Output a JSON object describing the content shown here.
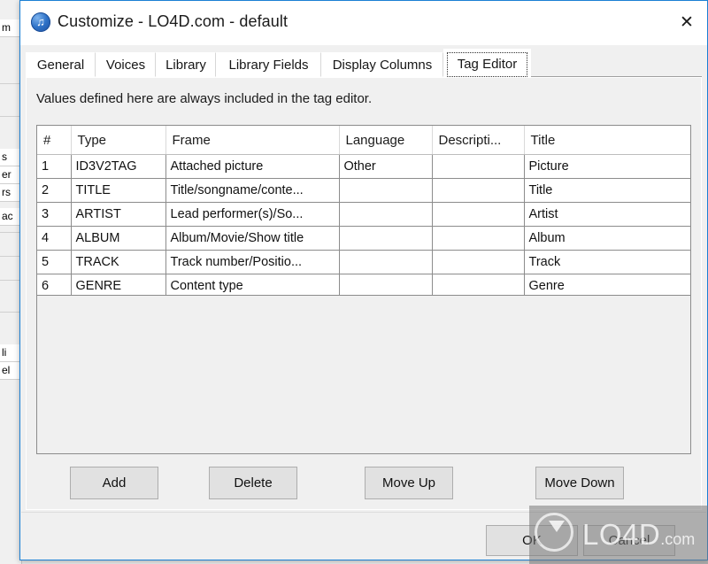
{
  "window": {
    "title": "Customize - LO4D.com - default",
    "icon": "music-note-icon",
    "close_label": "✕",
    "accent_border": "#1a7fd4"
  },
  "tabs": [
    {
      "label": "General",
      "active": false
    },
    {
      "label": "Voices",
      "active": false
    },
    {
      "label": "Library",
      "active": false
    },
    {
      "label": "Library Fields",
      "active": false
    },
    {
      "label": "Display Columns",
      "active": false
    },
    {
      "label": "Tag Editor",
      "active": true
    }
  ],
  "panel": {
    "description": "Values defined here are always included in the tag editor."
  },
  "grid": {
    "columns": [
      "#",
      "Type",
      "Frame",
      "Language",
      "Descripti...",
      "Title"
    ],
    "rows": [
      {
        "num": "1",
        "type": "ID3V2TAG",
        "frame": "Attached picture",
        "language": "Other",
        "description": "",
        "title": "Picture"
      },
      {
        "num": "2",
        "type": "TITLE",
        "frame": "Title/songname/conte...",
        "language": "",
        "description": "",
        "title": "Title"
      },
      {
        "num": "3",
        "type": "ARTIST",
        "frame": "Lead performer(s)/So...",
        "language": "",
        "description": "",
        "title": "Artist"
      },
      {
        "num": "4",
        "type": "ALBUM",
        "frame": "Album/Movie/Show title",
        "language": "",
        "description": "",
        "title": "Album"
      },
      {
        "num": "5",
        "type": "TRACK",
        "frame": "Track number/Positio...",
        "language": "",
        "description": "",
        "title": "Track"
      },
      {
        "num": "6",
        "type": "GENRE",
        "frame": "Content type",
        "language": "",
        "description": "",
        "title": "Genre"
      }
    ]
  },
  "actions": {
    "add": "Add",
    "delete": "Delete",
    "move_up": "Move Up",
    "move_down": "Move Down"
  },
  "footer": {
    "ok": "OK",
    "cancel": "Cancel"
  },
  "watermark": {
    "text": "LO4D",
    "suffix": ".com"
  },
  "background_window": {
    "items": [
      {
        "text": "m",
        "selected": false
      },
      {
        "text": "",
        "selected": false
      },
      {
        "text": "",
        "selected": false
      },
      {
        "text": "s",
        "selected": false
      },
      {
        "text": "er",
        "selected": false
      },
      {
        "text": "rs",
        "selected": false
      },
      {
        "text": "ac",
        "selected": false
      },
      {
        "text": "",
        "selected": false
      },
      {
        "text": "",
        "selected": true
      },
      {
        "text": "",
        "selected": false
      },
      {
        "text": "",
        "selected": false
      },
      {
        "text": "li",
        "selected": false
      },
      {
        "text": "el",
        "selected": false
      }
    ]
  }
}
